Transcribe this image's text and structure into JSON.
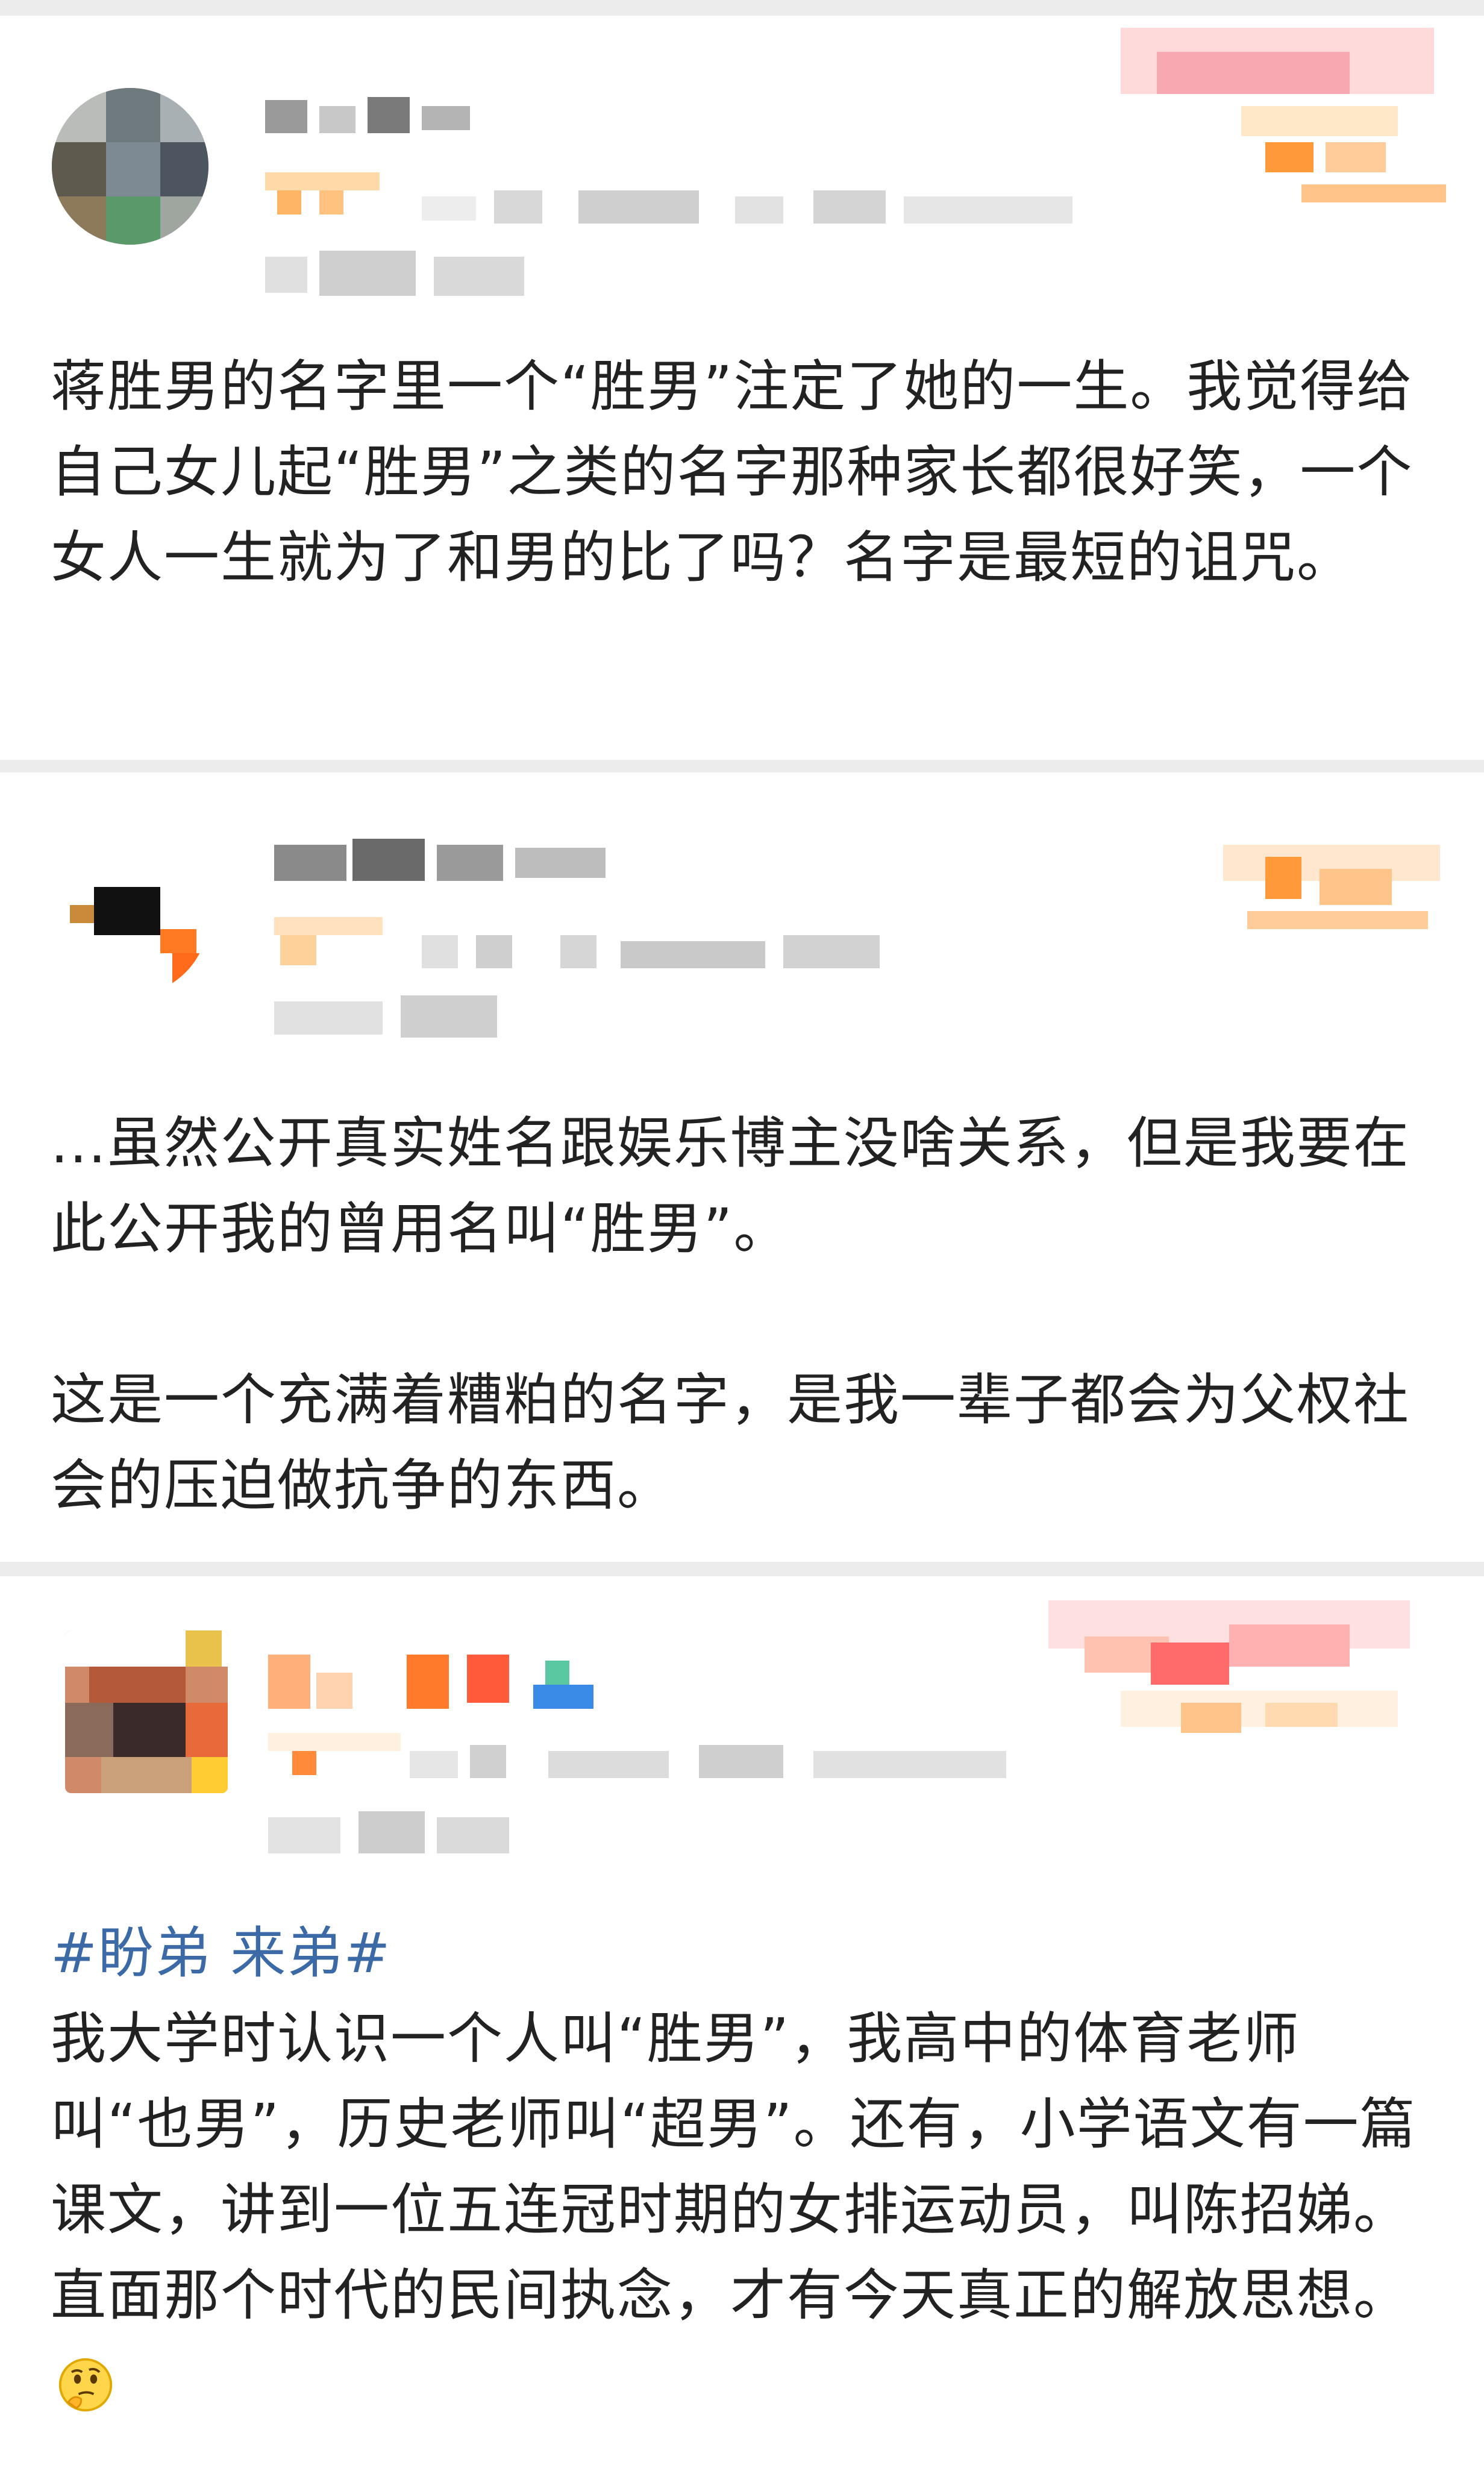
{
  "posts": [
    {
      "author": "",
      "body": "蒋胜男的名字里一个“胜男”注定了她的一生。我觉得给自己女儿起“胜男”之类的名字那种家长都很好笑，一个女人一生就为了和男的比了吗？名字是最短的诅咒。"
    },
    {
      "author": "",
      "paragraph1": "...虽然公开真实姓名跟娱乐博主没啥关系，但是我要在此公开我的曾用名叫“胜男”。",
      "paragraph2": "这是一个充满着糟粕的名字，是我一辈子都会为父权社会的压迫做抗争的东西。"
    },
    {
      "author": "",
      "hashtag": "#盼弟 来弟#",
      "body": "我大学时认识一个人叫“胜男”，我高中的体育老师叫“也男”，历史老师叫“超男”。还有，小学语文有一篇课文，讲到一位五连冠时期的女排运动员，叫陈招娣。直面那个时代的民间执念，才有今天真正的解放思想。",
      "emoji": "thinking-face-emoji"
    }
  ],
  "colors": {
    "background": "#ececec",
    "card": "#ffffff",
    "text": "#222222",
    "hashtag": "#3b6aa6"
  }
}
